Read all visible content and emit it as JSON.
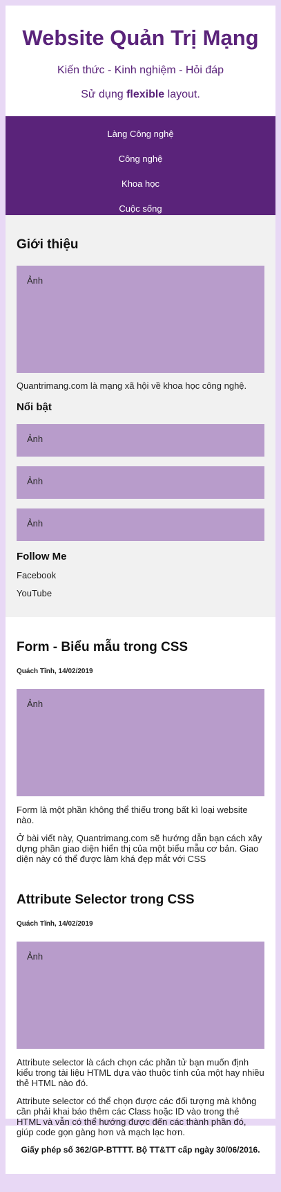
{
  "header": {
    "title": "Website Quản Trị Mạng",
    "tagline": "Kiến thức - Kinh nghiệm - Hỏi đáp",
    "layout_note_prefix": "Sử dụng ",
    "layout_note_bold": "flexible",
    "layout_note_suffix": " layout."
  },
  "nav": {
    "items": [
      {
        "label": "Làng Công nghệ"
      },
      {
        "label": "Công nghệ"
      },
      {
        "label": "Khoa học"
      },
      {
        "label": "Cuộc sống"
      }
    ]
  },
  "sidebar": {
    "intro_title": "Giới thiệu",
    "intro_image_label": "Ảnh",
    "intro_text": "Quantrimang.com là mạng xã hội về khoa học công nghệ.",
    "featured_title": "Nổi bật",
    "featured_images": [
      "Ảnh",
      "Ảnh",
      "Ảnh"
    ],
    "follow_title": "Follow Me",
    "follow_links": [
      "Facebook",
      "YouTube"
    ]
  },
  "posts": [
    {
      "title": "Form - Biểu mẫu trong CSS",
      "meta": "Quách Tĩnh, 14/02/2019",
      "image_label": "Ảnh",
      "paragraphs": [
        "Form là một phần không thể thiếu trong bất kì loại website nào.",
        "Ở bài viết này, Quantrimang.com sẽ hướng dẫn bạn cách xây dựng phần giao diện hiển thị của một biểu mẫu cơ bản. Giao diện này có thể được làm khá đẹp mắt với CSS"
      ]
    },
    {
      "title": "Attribute Selector trong CSS",
      "meta": "Quách Tĩnh, 14/02/2019",
      "image_label": "Ảnh",
      "paragraphs": [
        "Attribute selector là cách chọn các phần tử bạn muốn định kiểu trong tài liệu HTML dựa vào thuộc tính của một hay nhiều thẻ HTML nào đó.",
        "Attribute selector có thể chọn được các đối tượng mà không cần phải khai báo thêm các Class hoặc ID vào trong thẻ HTML và vẫn có thể hướng được đến các thành phần đó, giúp code gọn gàng hơn và mạch lạc hơn."
      ]
    }
  ],
  "footer": {
    "text": "Giấy phép số 362/GP-BTTTT. Bộ TT&TT cấp ngày 30/06/2016."
  },
  "colors": {
    "brand": "#5a237a",
    "page_bg": "#e8d8f5",
    "image_placeholder": "#b89ccb",
    "sidebar_bg": "#f1f1f1"
  }
}
